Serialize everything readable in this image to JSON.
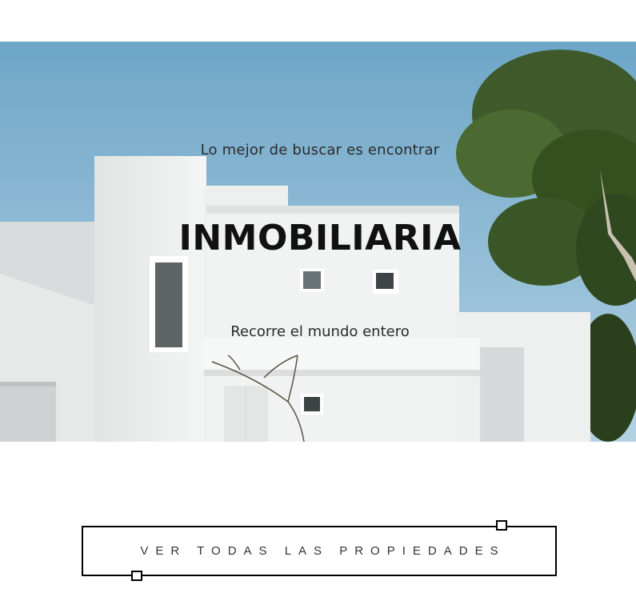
{
  "hero": {
    "tagline": "Lo mejor de buscar es encontrar",
    "title": "INMOBILIARIA",
    "subtitle": "Recorre el mundo entero",
    "image_description_icon": "house-photo"
  },
  "cta": {
    "label": "VER TODAS LAS PROPIEDADES"
  },
  "colors": {
    "sky": "#8cbad4",
    "wall": "#eceeee",
    "tree": "#3f5a2c",
    "border": "#000000"
  }
}
